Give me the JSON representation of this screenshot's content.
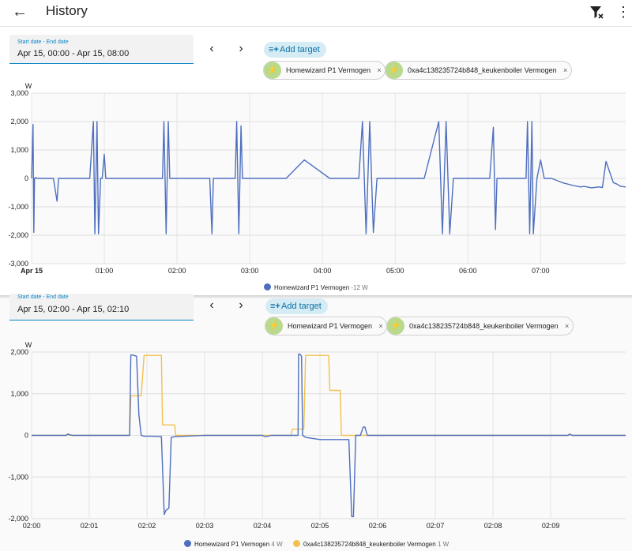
{
  "header": {
    "title": "History",
    "back_icon": "arrow-left-icon",
    "filter_icon": "filter-remove-icon",
    "menu_icon": "dots-vertical-icon"
  },
  "colors": {
    "accent": "#0a84c4",
    "series_p1": "#4e6fbf",
    "series_boiler": "#f2c14e",
    "chip_icon_bg": "#b9d98c"
  },
  "top": {
    "date_range": {
      "label": "Start date - End date",
      "value": "Apr 15, 00:00 - Apr 15, 08:00"
    },
    "add_target_label": "Add target",
    "chips": [
      {
        "label": "Homewizard P1 Vermogen",
        "icon": "flash-icon"
      },
      {
        "label": "0xa4c138235724b848_keukenboiler Vermogen",
        "icon": "flash-icon"
      }
    ],
    "legend": [
      {
        "name": "Homewizard P1 Vermogen",
        "value": "-12 W"
      }
    ]
  },
  "bottom": {
    "date_range": {
      "label": "Start date - End date",
      "value": "Apr 15, 02:00 - Apr 15, 02:10"
    },
    "add_target_label": "Add target",
    "chips": [
      {
        "label": "Homewizard P1 Vermogen",
        "icon": "flash-icon"
      },
      {
        "label": "0xa4c138235724b848_keukenboiler Vermogen",
        "icon": "flash-icon"
      }
    ],
    "legend": [
      {
        "name": "Homewizard P1 Vermogen",
        "value": "4 W"
      },
      {
        "name": "0xa4c138235724b848_keukenboiler Vermogen",
        "value": "1 W"
      }
    ]
  },
  "chart_data": [
    {
      "type": "line",
      "ylabel": "W",
      "ylim": [
        -3000,
        3000
      ],
      "yticks": [
        -3000,
        -2000,
        -1000,
        0,
        1000,
        2000,
        3000
      ],
      "ytick_labels": [
        "-3,000",
        "-2,000",
        "-1,000",
        "0",
        "1,000",
        "2,000",
        "3,000"
      ],
      "xlim": [
        0,
        8.17
      ],
      "xticks": [
        0,
        1,
        2,
        3,
        4,
        5,
        6,
        7
      ],
      "xtick_labels": [
        "Apr 15",
        "01:00",
        "02:00",
        "03:00",
        "04:00",
        "05:00",
        "06:00",
        "07:00"
      ],
      "grid": true,
      "legend_position": "bottom-center",
      "series": [
        {
          "name": "Homewizard P1 Vermogen",
          "x": [
            0,
            0.02,
            0.03,
            0.04,
            0.05,
            0.06,
            0.08,
            0.3,
            0.35,
            0.37,
            0.4,
            0.8,
            0.85,
            0.87,
            0.9,
            0.92,
            0.95,
            0.97,
            1.0,
            1.02,
            1.05,
            1.8,
            1.82,
            1.85,
            1.88,
            1.9,
            2.45,
            2.48,
            2.5,
            2.8,
            2.82,
            2.85,
            2.88,
            2.9,
            3.5,
            3.75,
            4.1,
            4.5,
            4.55,
            4.6,
            4.65,
            4.7,
            4.75,
            4.8,
            5.4,
            5.6,
            5.65,
            5.7,
            5.75,
            5.8,
            6.3,
            6.35,
            6.38,
            6.4,
            6.5,
            6.8,
            6.82,
            6.85,
            6.88,
            6.9,
            6.95,
            7.0,
            7.05,
            7.15,
            7.3,
            7.45,
            7.55,
            7.6,
            7.7,
            7.8,
            7.85,
            7.9,
            8.0,
            8.05,
            8.1,
            8.17
          ],
          "y": [
            0,
            1900,
            -1900,
            0,
            0,
            30,
            0,
            0,
            -800,
            0,
            0,
            0,
            2000,
            -1950,
            2000,
            -1950,
            0,
            0,
            850,
            0,
            0,
            0,
            2000,
            -1950,
            2000,
            0,
            0,
            -1950,
            0,
            0,
            2000,
            -1950,
            1850,
            0,
            0,
            650,
            0,
            0,
            2000,
            -1950,
            2000,
            -1900,
            0,
            0,
            0,
            2000,
            -1950,
            2000,
            -1950,
            0,
            0,
            1800,
            -1800,
            0,
            0,
            0,
            2000,
            -1950,
            2000,
            -1950,
            0,
            650,
            0,
            0,
            -150,
            -250,
            -300,
            -280,
            -330,
            -300,
            -320,
            600,
            -150,
            -200,
            -280,
            -300
          ]
        }
      ]
    },
    {
      "type": "line",
      "ylabel": "W",
      "ylim": [
        -2000,
        2000
      ],
      "yticks": [
        -2000,
        -1000,
        0,
        1000,
        2000
      ],
      "ytick_labels": [
        "-2,000",
        "-1,000",
        "0",
        "1,000",
        "2,000"
      ],
      "xlim": [
        0,
        10.3
      ],
      "xticks": [
        0,
        1,
        2,
        3,
        4,
        5,
        6,
        7,
        8,
        9
      ],
      "xtick_labels": [
        "02:00",
        "02:01",
        "02:02",
        "02:03",
        "02:04",
        "02:05",
        "02:06",
        "02:07",
        "02:08",
        "02:09"
      ],
      "grid": true,
      "legend_position": "bottom-center",
      "series": [
        {
          "name": "Homewizard P1 Vermogen",
          "x": [
            0,
            0.6,
            0.63,
            0.7,
            1.7,
            1.72,
            1.75,
            1.82,
            1.86,
            1.9,
            1.95,
            2.05,
            2.25,
            2.3,
            2.33,
            2.38,
            2.42,
            2.5,
            3.0,
            4.0,
            4.05,
            4.1,
            4.15,
            4.5,
            4.62,
            4.63,
            4.65,
            4.68,
            4.7,
            4.75,
            5.0,
            5.5,
            5.55,
            5.58,
            5.62,
            5.7,
            5.75,
            5.78,
            5.82,
            6.0,
            9.3,
            9.33,
            9.37,
            9.5,
            10.3
          ],
          "y": [
            0,
            0,
            30,
            0,
            0,
            1930,
            1930,
            1900,
            500,
            0,
            -20,
            -20,
            -30,
            -1900,
            -1800,
            -1750,
            -50,
            -30,
            0,
            0,
            -30,
            -20,
            0,
            0,
            0,
            1950,
            1950,
            1900,
            0,
            -50,
            -100,
            -100,
            -1950,
            -1950,
            0,
            0,
            200,
            200,
            0,
            0,
            0,
            30,
            0,
            0,
            0
          ]
        },
        {
          "name": "0xa4c138235724b848_keukenboiler Vermogen",
          "x": [
            0,
            0.6,
            0.62,
            0.65,
            1.7,
            1.72,
            1.74,
            1.9,
            1.95,
            2.25,
            2.27,
            2.48,
            2.5,
            4.5,
            4.52,
            4.55,
            4.72,
            4.75,
            5.15,
            5.17,
            5.35,
            5.37,
            6.0,
            9.3,
            9.32,
            9.36,
            10.3
          ],
          "y": [
            0,
            0,
            30,
            0,
            0,
            950,
            950,
            950,
            1920,
            1920,
            250,
            250,
            0,
            0,
            150,
            150,
            150,
            1920,
            1920,
            1080,
            1080,
            0,
            0,
            0,
            30,
            0,
            0
          ]
        }
      ]
    }
  ]
}
